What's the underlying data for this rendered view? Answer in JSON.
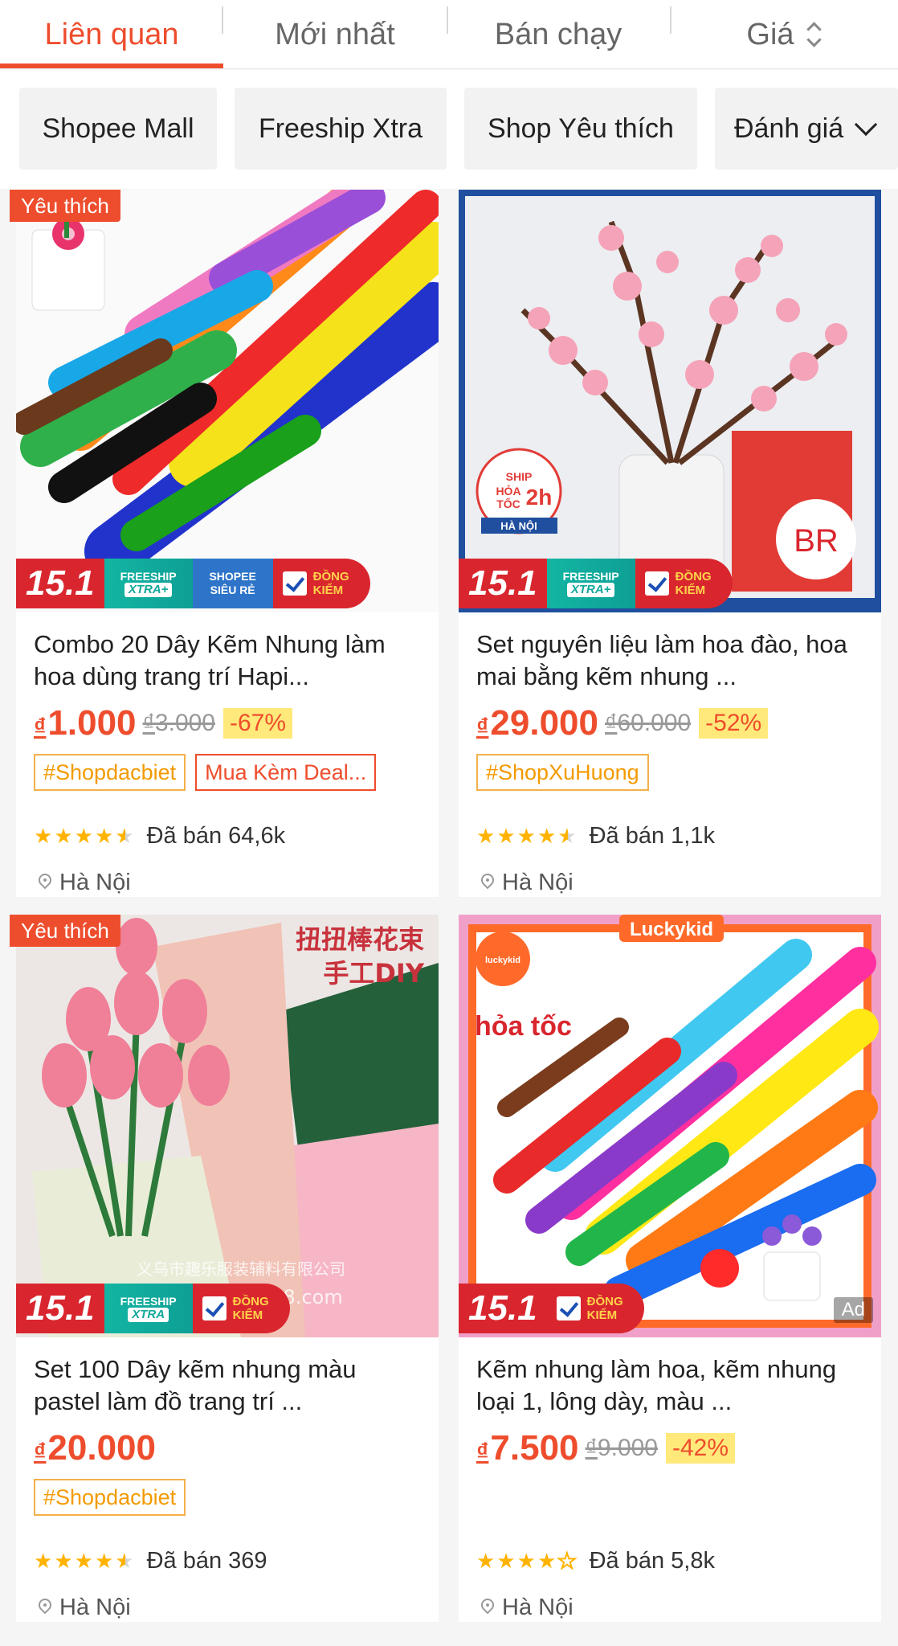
{
  "sort_tabs": [
    {
      "label": "Liên quan",
      "active": true
    },
    {
      "label": "Mới nhất",
      "active": false
    },
    {
      "label": "Bán chạy",
      "active": false
    },
    {
      "label": "Giá",
      "active": false
    }
  ],
  "filters": [
    "Shopee Mall",
    "Freeship Xtra",
    "Shop Yêu thích",
    "Đánh giá"
  ],
  "colors": {
    "accent": "#ee4d2d",
    "star": "#ffb300",
    "tag_orange": "#f39a00",
    "discount_bg": "#ffe97a"
  },
  "badges": {
    "favorite": "Yêu thích",
    "promo_date": "15.1",
    "freeship_top": "FREESHIP",
    "freeship_bottom": "XTRA+",
    "sieu_top": "SHOPEE",
    "sieu_bottom": "SIÊU RẺ",
    "dong_top": "ĐỒNG",
    "dong_bottom": "KIỂM",
    "ad": "Ad"
  },
  "products": [
    {
      "title": "Combo 20 Dây Kẽm Nhung làm hoa dùng trang trí Hapi...",
      "currency": "₫",
      "price": "1.000",
      "old_price": "3.000",
      "discount": "-67%",
      "tags": [
        "#Shopdacbiet",
        "Mua Kèm Deal..."
      ],
      "rating": 4.5,
      "sold": "Đã bán 64,6k",
      "location": "Hà Nội",
      "favorite": true
    },
    {
      "title": "Set nguyên liệu làm hoa đào, hoa mai bằng kẽm nhung ...",
      "currency": "₫",
      "price": "29.000",
      "old_price": "60.000",
      "discount": "-52%",
      "tags": [
        "#ShopXuHuong"
      ],
      "rating": 4.5,
      "sold": "Đã bán 1,1k",
      "location": "Hà Nội",
      "favorite": false,
      "image_text": {
        "ship1": "SHIP",
        "ship2": "HỎA",
        "ship3": "TỐC",
        "ship4": "2h",
        "ship5": "HÀ NỘI",
        "logo": "BR"
      }
    },
    {
      "title": "Set 100 Dây kẽm nhung màu pastel làm đồ trang trí ...",
      "currency": "₫",
      "price": "20.000",
      "tags": [
        "#Shopdacbiet"
      ],
      "rating": 4.5,
      "sold": "Đã bán 369",
      "location": "Hà Nội",
      "favorite": true,
      "image_text": {
        "cn1": "扭扭棒花束",
        "cn2": "手工DIY",
        "wm1": "义乌市趣乐服装辅料有限公司",
        "wm2": "299.1688.com",
        "freeship_bottom": "XTRA"
      }
    },
    {
      "title": "Kẽm nhung làm hoa, kẽm nhung loại 1, lông dày, màu ...",
      "currency": "₫",
      "price": "7.500",
      "old_price": "9.000",
      "discount": "-42%",
      "tags": [],
      "rating": 4.0,
      "sold": "Đã bán 5,8k",
      "location": "Hà Nội",
      "favorite": false,
      "ad": true,
      "image_text": {
        "brand": "Luckykid",
        "logo": "luckykid",
        "hoatoc": "hỏa tốc"
      }
    }
  ]
}
